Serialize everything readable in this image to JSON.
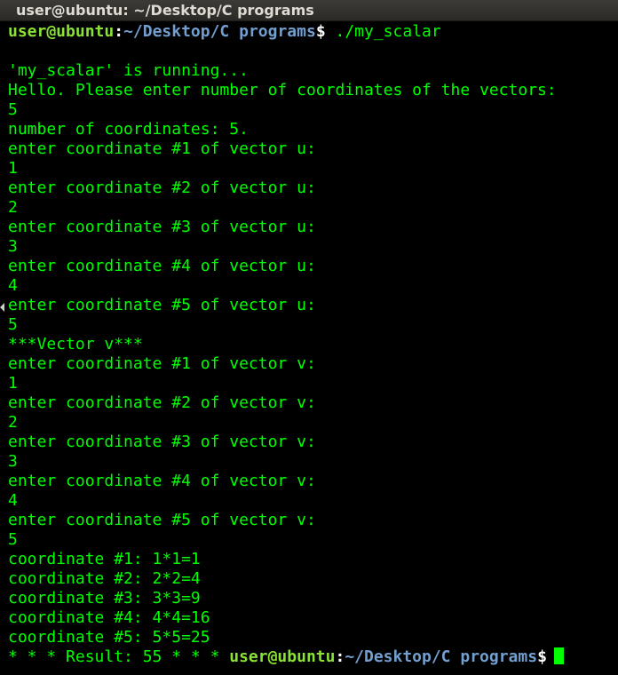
{
  "window": {
    "title": "user@ubuntu: ~/Desktop/C programs"
  },
  "prompt": {
    "user_host": "user@ubuntu",
    "separator": ":",
    "path": "~/Desktop/C programs",
    "symbol": "$"
  },
  "command": " ./my_scalar",
  "output_lines": [
    "",
    "'my_scalar' is running...",
    "Hello. Please enter number of coordinates of the vectors:",
    "5",
    "number of coordinates: 5.",
    "enter coordinate #1 of vector u:",
    "1",
    "enter coordinate #2 of vector u:",
    "2",
    "enter coordinate #3 of vector u:",
    "3",
    "enter coordinate #4 of vector u:",
    "4",
    "enter coordinate #5 of vector u:",
    "5",
    "***Vector v***",
    "enter coordinate #1 of vector v:",
    "1",
    "enter coordinate #2 of vector v:",
    "2",
    "enter coordinate #3 of vector v:",
    "3",
    "enter coordinate #4 of vector v:",
    "4",
    "enter coordinate #5 of vector v:",
    "5",
    "coordinate #1: 1*1=1",
    "coordinate #2: 2*2=4",
    "coordinate #3: 3*3=9",
    "coordinate #4: 4*4=16",
    "coordinate #5: 5*5=25"
  ],
  "result_text": "* * * Result: 55 * * * ",
  "colors": {
    "background": "#000000",
    "output_text": "#00ff00",
    "prompt_user": "#8ae234",
    "prompt_path": "#729fcf",
    "titlebar_text": "#dfdbd2"
  }
}
